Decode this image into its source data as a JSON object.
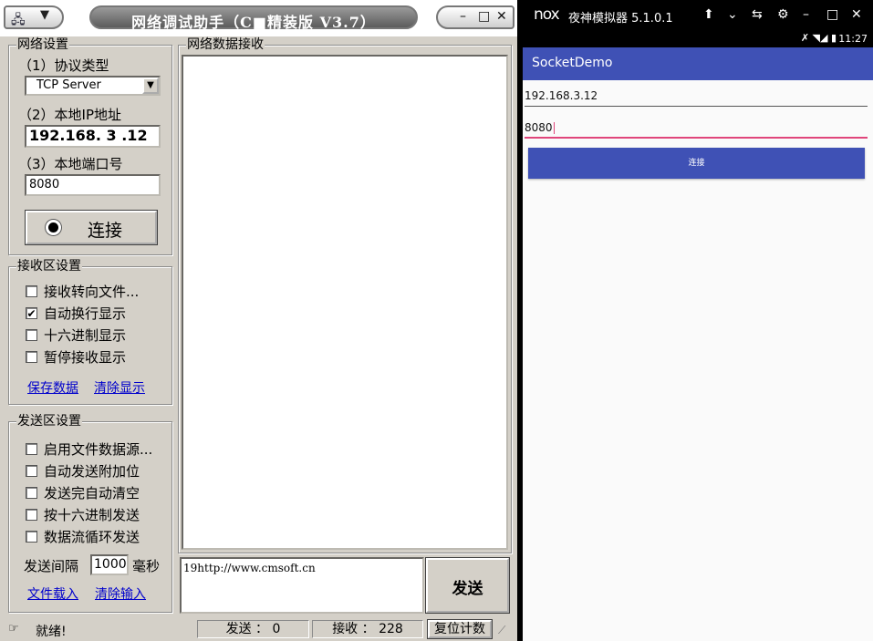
{
  "left_app": {
    "title": "网络调试助手（C■精装版 V3.7）",
    "window_controls": {
      "minimize": "–",
      "maximize": "□",
      "close": "✕"
    },
    "network_settings": {
      "group_title": "网络设置",
      "protocol_label": "（1）协议类型",
      "protocol_value": "TCP Server",
      "ip_label": "（2）本地IP地址",
      "ip_value": "192.168. 3 .12",
      "port_label": "（3）本地端口号",
      "port_value": "8080",
      "connect_label": "连接"
    },
    "receive_settings": {
      "group_title": "接收区设置",
      "options": [
        {
          "label": "接收转向文件...",
          "checked": false
        },
        {
          "label": "自动换行显示",
          "checked": true
        },
        {
          "label": "十六进制显示",
          "checked": false
        },
        {
          "label": "暂停接收显示",
          "checked": false
        }
      ],
      "save_link": "保存数据",
      "clear_link": "清除显示"
    },
    "send_settings": {
      "group_title": "发送区设置",
      "options": [
        {
          "label": "启用文件数据源...",
          "checked": false
        },
        {
          "label": "自动发送附加位",
          "checked": false
        },
        {
          "label": "发送完自动清空",
          "checked": false
        },
        {
          "label": "按十六进制发送",
          "checked": false
        },
        {
          "label": "数据流循环发送",
          "checked": false
        }
      ],
      "interval_label": "发送间隔",
      "interval_value": "1000",
      "interval_unit": "毫秒",
      "load_file_link": "文件载入",
      "clear_input_link": "清除输入"
    },
    "receive_area": {
      "title": "网络数据接收"
    },
    "send_text": "19http://www.cmsoft.cn",
    "send_button": "发送",
    "status": {
      "ready": "就绪!",
      "sent": "发送 ： 0",
      "received": "接收 ： 228",
      "reset_button": "复位计数"
    }
  },
  "right_app": {
    "nox_logo": "nox",
    "nox_title": "夜神模拟器 5.1.0.1",
    "nox_icons": [
      "pin-icon",
      "chevron-down-icon",
      "sync-icon",
      "gear-icon",
      "minimize-icon",
      "maximize-icon",
      "close-icon"
    ],
    "time": "11:27",
    "app_name": "SocketDemo",
    "ip_value": "192.168.3.12",
    "port_value": "8080",
    "connect_button": "连接",
    "accent_color": "#3f51b5",
    "focus_color": "#e0457b"
  }
}
